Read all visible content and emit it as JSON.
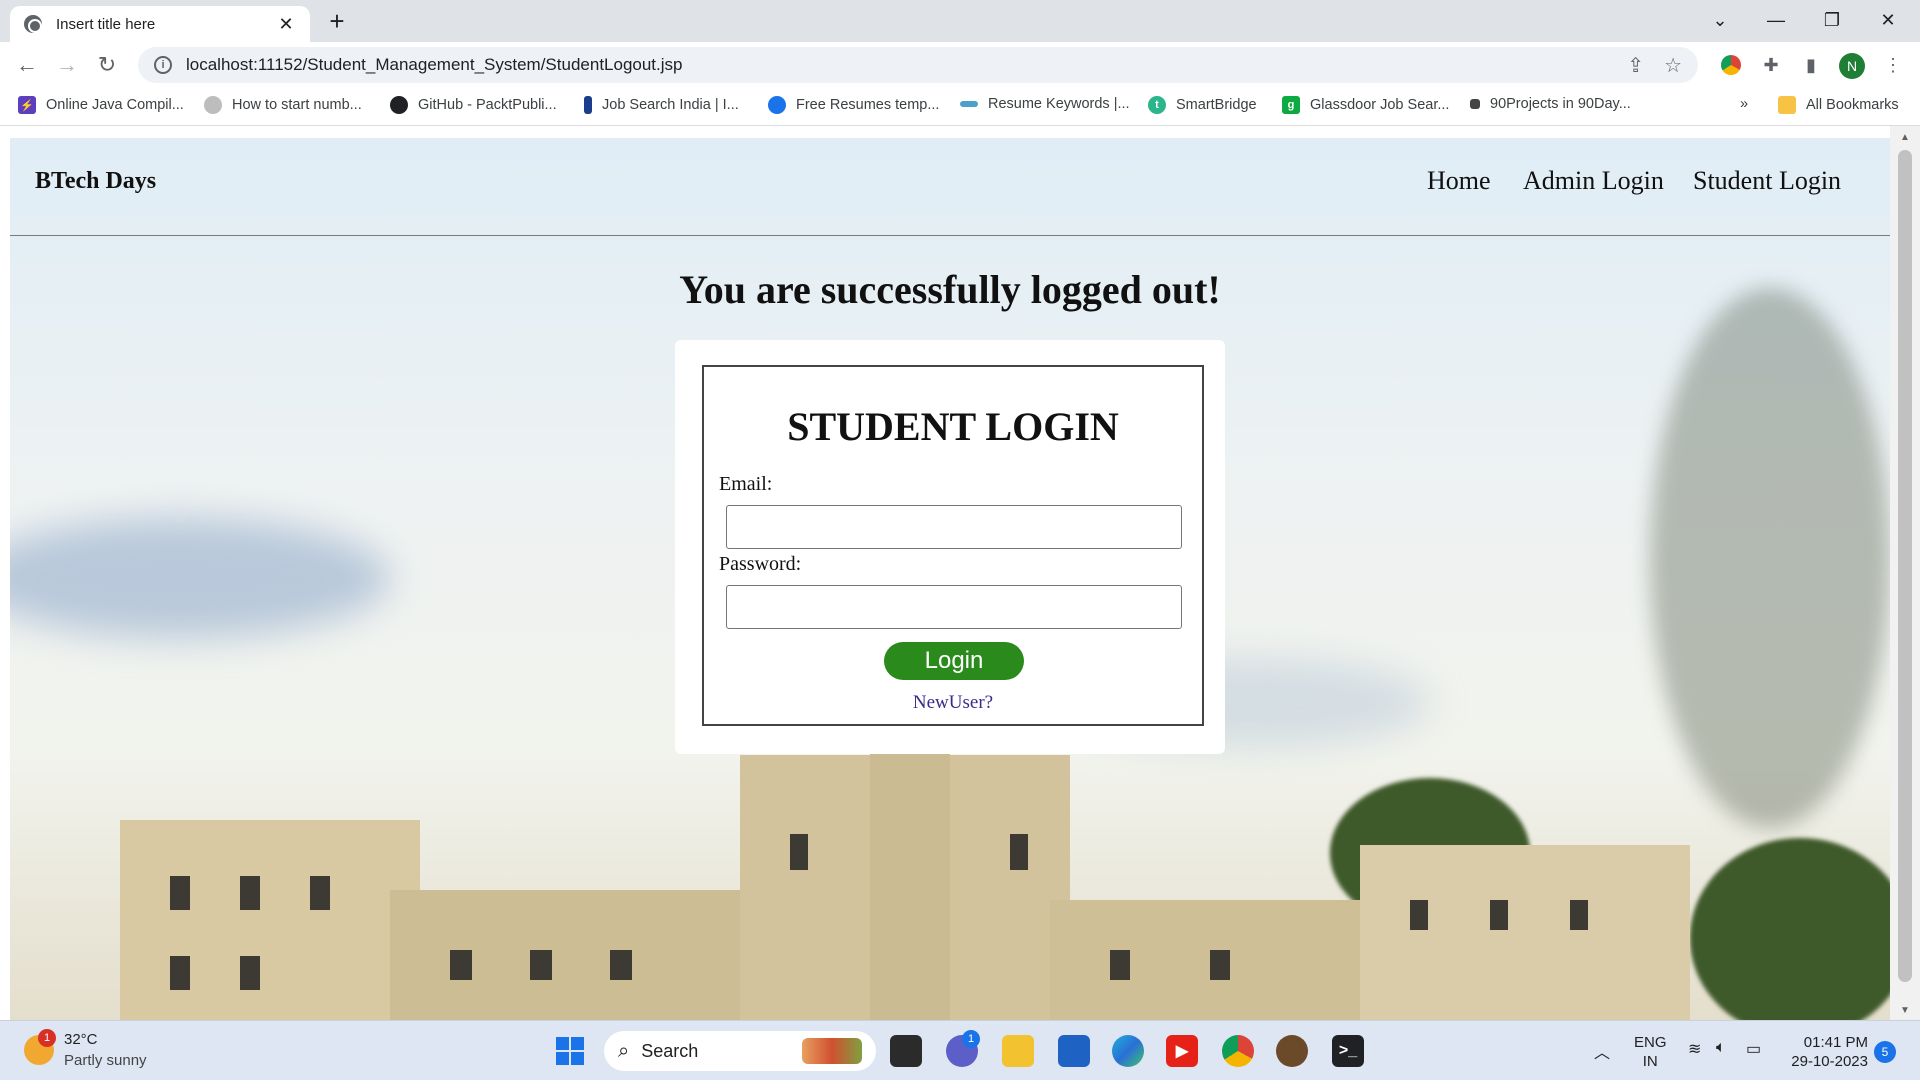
{
  "browser": {
    "tab_title": "Insert title here",
    "tab_close": "✕",
    "new_tab": "+",
    "url": "localhost:11152/Student_Management_System/StudentLogout.jsp",
    "profile_initial": "N",
    "bookmarks": [
      {
        "label": "Online Java Compil...",
        "color": "#5b3fbf"
      },
      {
        "label": "How to start numb...",
        "color": "#9e9e9e"
      },
      {
        "label": "GitHub - PacktPubli...",
        "color": "#202124"
      },
      {
        "label": "Job Search India | I...",
        "color": "#1a3e8c"
      },
      {
        "label": "Free Resumes temp...",
        "color": "#1a73e8"
      },
      {
        "label": "Resume Keywords |...",
        "color": "#4aa0c8"
      },
      {
        "label": "SmartBridge",
        "color": "#2bb58a"
      },
      {
        "label": "Glassdoor Job Sear...",
        "color": "#0caa41"
      },
      {
        "label": "90Projects in 90Day...",
        "color": "#444444"
      }
    ],
    "bookmarks_overflow": "»",
    "all_bookmarks": "All Bookmarks"
  },
  "site": {
    "brand": "BTech Days",
    "nav": [
      "Home",
      "Admin Login",
      "Student Login"
    ],
    "logout_message": "You are successfully logged out!",
    "login": {
      "title": "STUDENT LOGIN",
      "email_label": "Email:",
      "email_value": "",
      "password_label": "Password:",
      "password_value": "",
      "button": "Login",
      "new_user_link": "NewUser?"
    }
  },
  "taskbar": {
    "weather_badge": "1",
    "temperature": "32°C",
    "weather": "Partly sunny",
    "search_label": "Search",
    "chat_badge": "1",
    "lang_top": "ENG",
    "lang_bottom": "IN",
    "time": "01:41 PM",
    "date": "29-10-2023",
    "notifications": "5"
  },
  "colors": {
    "login_button": "#2a8a1c",
    "new_user_link": "#3b2a8a",
    "profile": "#1e7e34"
  }
}
